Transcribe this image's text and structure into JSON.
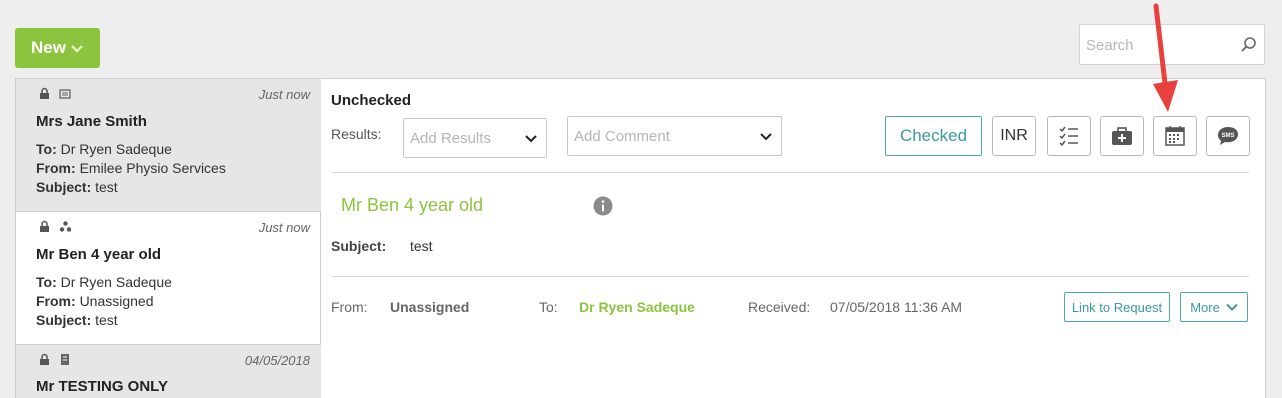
{
  "toolbar": {
    "new_label": "New"
  },
  "search": {
    "placeholder": "Search"
  },
  "messages": [
    {
      "time": "Just now",
      "name": "Mrs Jane Smith",
      "to_label": "To:",
      "to": "Dr Ryen Sadeque",
      "from_label": "From:",
      "from": "Emilee Physio Services",
      "subject_label": "Subject:",
      "subject": "test",
      "icons": [
        "lock-icon",
        "document-type-icon"
      ]
    },
    {
      "time": "Just now",
      "name": "Mr Ben 4 year old",
      "to_label": "To:",
      "to": "Dr Ryen Sadeque",
      "from_label": "From:",
      "from": "Unassigned",
      "subject_label": "Subject:",
      "subject": "test",
      "icons": [
        "lock-icon",
        "radiation-icon"
      ]
    },
    {
      "time": "04/05/2018",
      "name": "Mr TESTING ONLY",
      "icons": [
        "lock-icon",
        "pathology-icon"
      ]
    }
  ],
  "detail": {
    "status": "Unchecked",
    "results_label": "Results:",
    "results_placeholder": "Add Results",
    "comment_placeholder": "Add Comment",
    "checked_label": "Checked",
    "inr_label": "INR",
    "patient_name": "Mr Ben 4 year old",
    "subject_label": "Subject:",
    "subject_value": "test",
    "from_label": "From:",
    "from_value": "Unassigned",
    "to_label": "To:",
    "to_value": "Dr Ryen Sadeque",
    "received_label": "Received:",
    "received_value": "07/05/2018 11:36 AM",
    "link_label": "Link to Request",
    "more_label": "More",
    "action_icons": [
      "checklist-icon",
      "medical-kit-icon",
      "calendar-icon",
      "sms-icon"
    ]
  },
  "colors": {
    "accent_green": "#8cc43f",
    "teal": "#3a9aa3",
    "arrow_red": "#e8423f"
  }
}
